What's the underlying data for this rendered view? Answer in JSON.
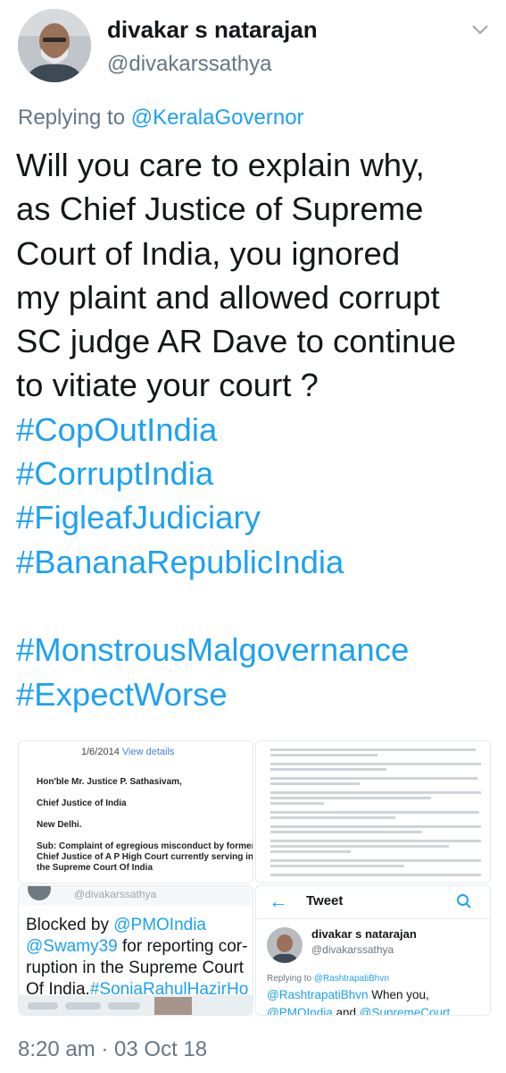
{
  "author": {
    "display_name": "divakar s natarajan",
    "handle": "@divakarssathya"
  },
  "reply": {
    "prefix": "Replying to",
    "to": "@KeralaGovernor"
  },
  "tweet": {
    "lines": [
      "Will you care to explain why,",
      "as Chief Justice of Supreme",
      "Court of India, you ignored",
      "my plaint and allowed corrupt",
      "SC judge AR Dave to continue",
      "to vitiate your court ?"
    ],
    "hashtags": [
      "#CopOutIndia",
      "#CorruptIndia",
      "#FigleafJudiciary",
      "#BananaRepublicIndia"
    ],
    "hashtags_2": [
      "#MonstrousMalgovernance",
      "#ExpectWorse"
    ]
  },
  "media": {
    "letter": {
      "date": "1/6/2014",
      "view_details": "View details",
      "lines": [
        "Hon'ble Mr. Justice P. Sathasivam,",
        "Chief Justice of India",
        "New Delhi.",
        "Sub: Complaint of egregious misconduct by former",
        "Chief Justice of A P High Court currently serving in",
        "the Supreme Court Of India"
      ]
    },
    "blocked_tweet": {
      "handle": "@divakarssathya",
      "text_1": "Blocked by ",
      "mention_1": "@PMOIndia",
      "mention_2": "@Swamy39",
      "text_2": " for reporting cor-ruption in the Supreme Court Of India.",
      "hashtag": "#SoniaRahulHazirHo"
    },
    "tweet_view": {
      "title": "Tweet",
      "name": "divakar s natarajan",
      "handle": "@divakarssathya",
      "reply_prefix": "Replying to",
      "reply_to": "@RashtrapatiBhvn",
      "mention_1": "@RashtrapatiBhvn",
      "text_1": " When you,",
      "mention_2": "@PMOIndia",
      "text_2": " and ",
      "mention_3": "@SupremeCourt"
    }
  },
  "timestamp": "8:20 am · 03 Oct 18",
  "colors": {
    "accent": "#1da1f2",
    "secondary": "#657786",
    "text": "#14171a"
  }
}
